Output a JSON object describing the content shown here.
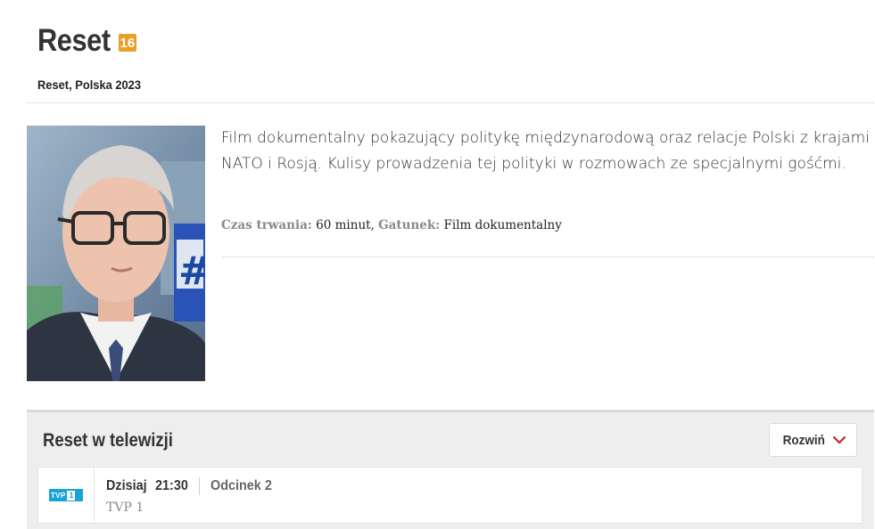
{
  "header": {
    "title": "Reset",
    "age_rating": "16",
    "subtitle": "Reset, Polska 2023"
  },
  "description": "Film dokumentalny pokazujący politykę międzynarodową oraz relacje Polski z krajami NATO i Rosją. Kulisy prowadzenia tej polityki w rozmowach ze specjalnymi gośćmi.",
  "meta": {
    "duration_label": "Czas trwania:",
    "duration_value": "60 minut,",
    "genre_label": "Gatunek:",
    "genre_value": "Film dokumentalny"
  },
  "tv_section": {
    "title": "Reset w telewizji",
    "expand_label": "Rozwiń",
    "airings": [
      {
        "channel_logo_text": "TVP",
        "channel_logo_number": "1",
        "day": "Dzisiaj",
        "time": "21:30",
        "episode": "Odcinek 2",
        "channel": "TVP 1"
      }
    ]
  },
  "colors": {
    "age_badge": "#e8a128",
    "chevron": "#c0252b",
    "channel_blue": "#1aa3d9"
  }
}
